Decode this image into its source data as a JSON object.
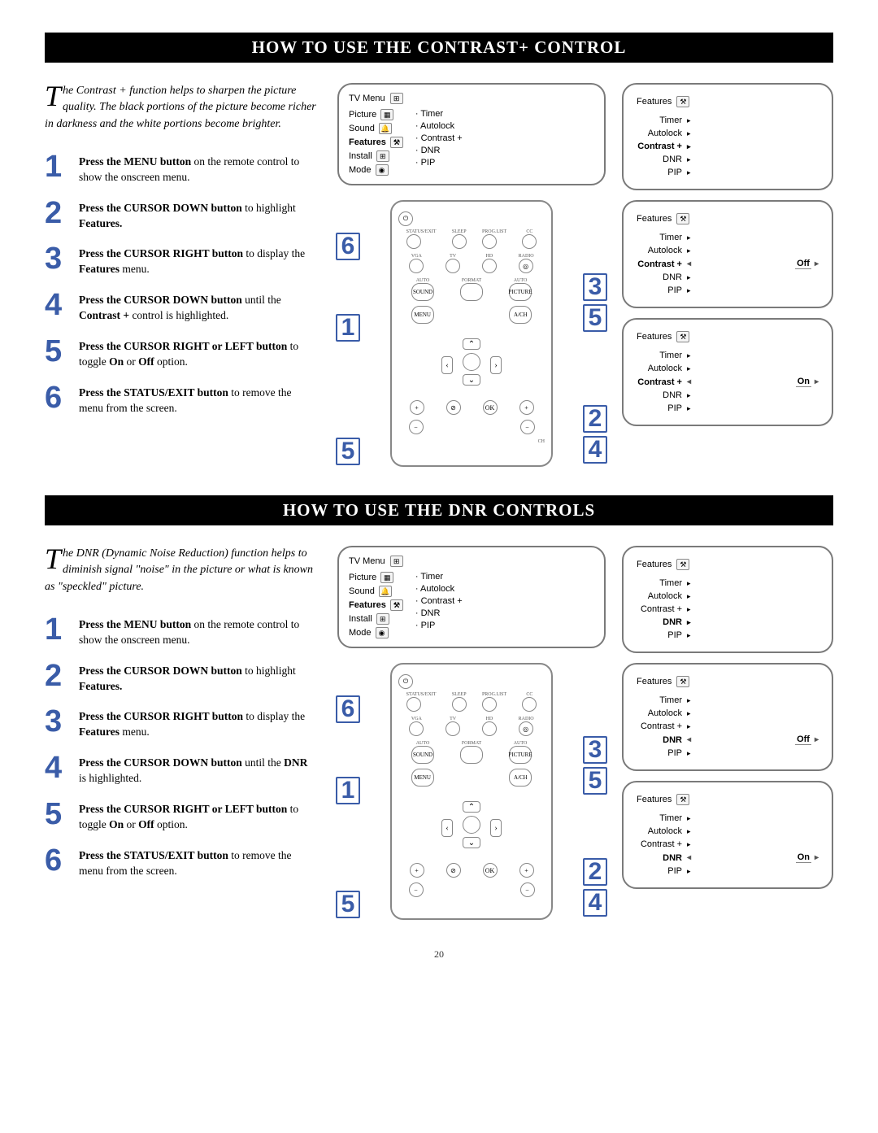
{
  "page_number": "20",
  "sections": [
    {
      "title": "HOW TO USE THE CONTRAST+ CONTROL",
      "intro_dropcap": "T",
      "intro": "he Contrast + function helps to sharpen the picture quality. The black portions of the picture become richer in darkness and the white portions become brighter.",
      "steps": [
        {
          "n": "1",
          "bold": "Press the MENU button",
          "rest": " on the remote control to show the onscreen menu."
        },
        {
          "n": "2",
          "bold": "Press the CURSOR DOWN button",
          "rest": " to highlight ",
          "bold2": "Features.",
          "rest2": ""
        },
        {
          "n": "3",
          "bold": "Press the CURSOR RIGHT button",
          "rest": " to display the ",
          "bold2": "Features",
          "rest2": " menu."
        },
        {
          "n": "4",
          "bold": "Press the CURSOR DOWN button",
          "rest": " until the ",
          "bold2": "Contrast +",
          "rest2": " control is highlighted."
        },
        {
          "n": "5",
          "bold": "Press the CURSOR RIGHT or LEFT button",
          "rest": " to toggle ",
          "bold2": "On",
          "rest2": " or ",
          "bold3": "Off",
          "rest3": " option."
        },
        {
          "n": "6",
          "bold": "Press the STATUS/EXIT button",
          "rest": " to remove the menu from the screen."
        }
      ],
      "tv_menu": {
        "header": "TV Menu",
        "left_items": [
          "Picture",
          "Sound",
          "Features",
          "Install",
          "Mode"
        ],
        "bold_item": "Features",
        "right_items": [
          "Timer",
          "Autolock",
          "Contrast +",
          "DNR",
          "PIP"
        ]
      },
      "feature_menus": [
        {
          "header": "Features",
          "items": [
            "Timer",
            "Autolock",
            "Contrast +",
            "DNR",
            "PIP"
          ],
          "bold": "Contrast +",
          "value": null
        },
        {
          "header": "Features",
          "items": [
            "Timer",
            "Autolock",
            "Contrast +",
            "DNR",
            "PIP"
          ],
          "bold": "Contrast +",
          "value": "Off"
        },
        {
          "header": "Features",
          "items": [
            "Timer",
            "Autolock",
            "Contrast +",
            "DNR",
            "PIP"
          ],
          "bold": "Contrast +",
          "value": "On"
        }
      ],
      "remote_labels": {
        "row1": [
          "STATUS/EXIT",
          "SLEEP",
          "PROG.LIST",
          "CC"
        ],
        "row2": [
          "VGA",
          "TV",
          "HD",
          "RADIO"
        ],
        "row3": [
          "AUTO",
          "FORMAT",
          "AUTO"
        ],
        "row4": [
          "SOUND",
          "",
          "PICTURE"
        ],
        "menu": "MENU",
        "av": "A/CH",
        "ok": "OK",
        "vol": "+",
        "volm": "-",
        "ch": "CH"
      },
      "callouts": [
        "1",
        "2",
        "3",
        "4",
        "5",
        "5",
        "6"
      ]
    },
    {
      "title": "HOW TO USE THE DNR CONTROLS",
      "intro_dropcap": "T",
      "intro": "he DNR (Dynamic Noise Reduction) function helps to diminish signal \"noise\" in the picture or what is known as \"speckled\" picture.",
      "steps": [
        {
          "n": "1",
          "bold": "Press the MENU button",
          "rest": " on the remote control to show the onscreen menu."
        },
        {
          "n": "2",
          "bold": "Press the CURSOR DOWN button",
          "rest": " to highlight ",
          "bold2": "Features.",
          "rest2": ""
        },
        {
          "n": "3",
          "bold": "Press the CURSOR RIGHT button",
          "rest": " to display the ",
          "bold2": "Features",
          "rest2": " menu."
        },
        {
          "n": "4",
          "bold": "Press the CURSOR DOWN button",
          "rest": " until the ",
          "bold2": "DNR",
          "rest2": " is highlighted."
        },
        {
          "n": "5",
          "bold": "Press the CURSOR RIGHT or LEFT button",
          "rest": " to toggle ",
          "bold2": "On",
          "rest2": " or ",
          "bold3": "Off",
          "rest3": " option."
        },
        {
          "n": "6",
          "bold": "Press the STATUS/EXIT button",
          "rest": " to remove the menu from the screen."
        }
      ],
      "tv_menu": {
        "header": "TV Menu",
        "left_items": [
          "Picture",
          "Sound",
          "Features",
          "Install",
          "Mode"
        ],
        "bold_item": "Features",
        "right_items": [
          "Timer",
          "Autolock",
          "Contrast +",
          "DNR",
          "PIP"
        ]
      },
      "feature_menus": [
        {
          "header": "Features",
          "items": [
            "Timer",
            "Autolock",
            "Contrast +",
            "DNR",
            "PIP"
          ],
          "bold": "DNR",
          "value": null
        },
        {
          "header": "Features",
          "items": [
            "Timer",
            "Autolock",
            "Contrast +",
            "DNR",
            "PIP"
          ],
          "bold": "DNR",
          "value": "Off"
        },
        {
          "header": "Features",
          "items": [
            "Timer",
            "Autolock",
            "Contrast +",
            "DNR",
            "PIP"
          ],
          "bold": "DNR",
          "value": "On"
        }
      ]
    }
  ]
}
